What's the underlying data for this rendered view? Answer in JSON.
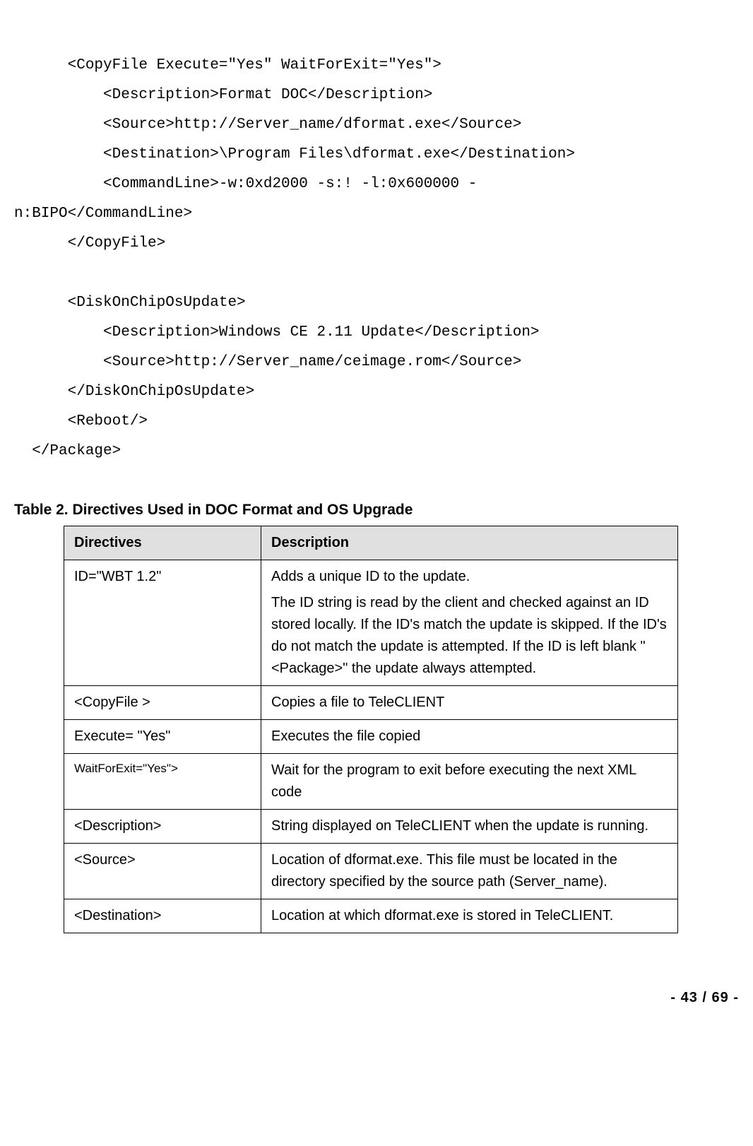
{
  "code": {
    "l1": "      <CopyFile Execute=\"Yes\" WaitForExit=\"Yes\">",
    "l2": "          <Description>Format DOC</Description>",
    "l3": "          <Source>http://Server_name/dformat.exe</Source>",
    "l4": "          <Destination>\\Program Files\\dformat.exe</Destination>",
    "l5": "          <CommandLine>-w:0xd2000 -s:! -l:0x600000 -",
    "l6": "n:BIPO</CommandLine>",
    "l7": "      </CopyFile>",
    "l8": "",
    "l9": "      <DiskOnChipOsUpdate>",
    "l10": "          <Description>Windows CE 2.11 Update</Description>",
    "l11": "          <Source>http://Server_name/ceimage.rom</Source>",
    "l12": "      </DiskOnChipOsUpdate>",
    "l13": "      <Reboot/>",
    "l14": "  </Package>"
  },
  "table": {
    "title": "Table 2. Directives Used in DOC Format and OS Upgrade",
    "headers": {
      "col1": "Directives",
      "col2": "Description"
    },
    "rows": [
      {
        "directive": "ID=\"WBT 1.2\"",
        "desc1": "Adds a unique ID to the update.",
        "desc2": "The ID string is read by the client and checked against an ID stored locally.  If the ID's match the update is skipped.  If the ID's do not match the update is attempted.  If the ID is left blank \"<Package>\" the update always attempted."
      },
      {
        "directive": "<CopyFile >",
        "desc1": "Copies a file to TeleCLIENT"
      },
      {
        "directive": "Execute= \"Yes\"",
        "desc1": "Executes the file copied"
      },
      {
        "directive": "WaitForExit=\"Yes\">",
        "directive_small": true,
        "desc1": "Wait for the program to exit before executing the next XML code"
      },
      {
        "directive": "<Description>",
        "desc1": "String displayed on TeleCLIENT when the update is running."
      },
      {
        "directive": "<Source>",
        "desc1": "Location of dformat.exe.  This file must be located in the directory specified by the source path (Server_name)."
      },
      {
        "directive": "<Destination>",
        "desc1": "Location at which dformat.exe is stored in TeleCLIENT."
      }
    ]
  },
  "footer": "- 43 / 69 -"
}
